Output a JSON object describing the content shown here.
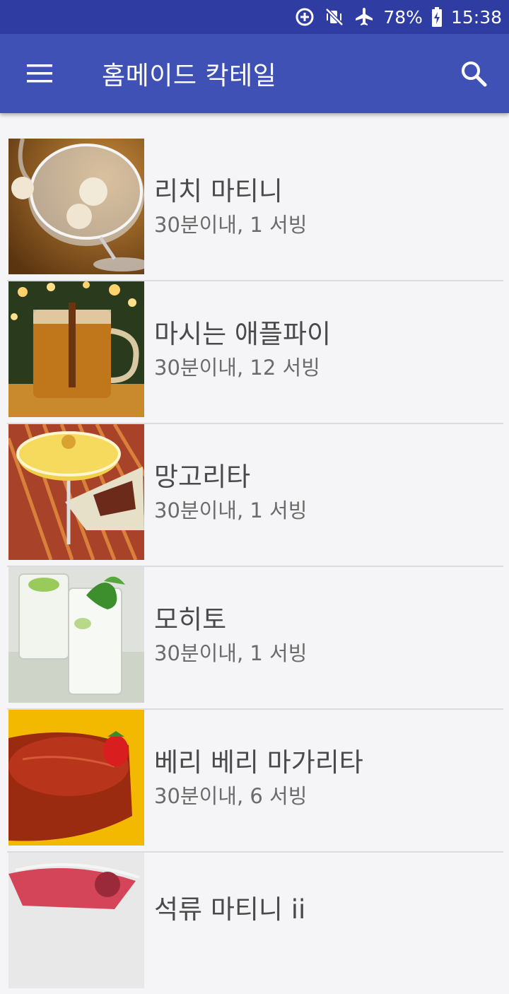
{
  "status_bar": {
    "battery": "78%",
    "time": "15:38"
  },
  "app_bar": {
    "title": "홈메이드 칵테일"
  },
  "recipes": [
    {
      "name": "리치 마티니",
      "meta": "30분이내, 1 서빙",
      "thumb_icon": "lychee-martini-photo"
    },
    {
      "name": "마시는 애플파이",
      "meta": "30분이내, 12 서빙",
      "thumb_icon": "apple-pie-drink-photo"
    },
    {
      "name": "망고리타",
      "meta": "30분이내, 1 서빙",
      "thumb_icon": "mangorita-photo"
    },
    {
      "name": "모히토",
      "meta": "30분이내, 1 서빙",
      "thumb_icon": "mojito-photo"
    },
    {
      "name": "베리 베리 마가리타",
      "meta": "30분이내, 6 서빙",
      "thumb_icon": "berry-margarita-photo"
    },
    {
      "name": "석류 마티니 ii",
      "meta": "",
      "thumb_icon": "pomegranate-martini-photo"
    }
  ],
  "colors": {
    "app_bar": "#3f51b5",
    "status_bar": "#2f3da3",
    "background": "#f5f5f7"
  }
}
